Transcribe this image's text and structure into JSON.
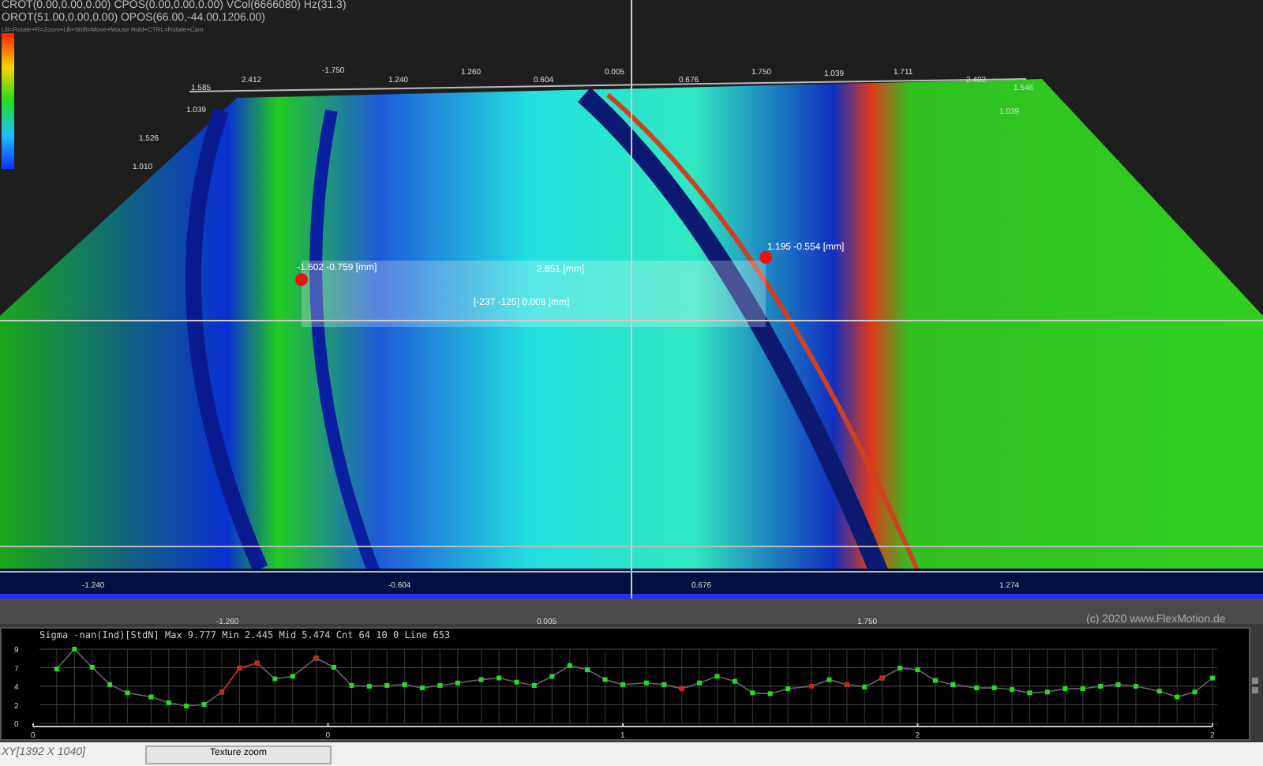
{
  "header": {
    "lines": [
      "CROT(0.00,0.00,0.00) CPOS(0.00,0.00,0.00) VCol(6666080) Hz(31.3)",
      "OROT(51.00,0.00,0.00) OPOS(66.00,-44.00,1206.00)"
    ],
    "hint": "LB=Rotate+R=Zoom+LB+Shift=Move+Mouse Hold+CTRL=Rotate+Cam"
  },
  "axis_labels": [
    "1.585",
    "2.412",
    "-1.750",
    "1.240",
    "1.260",
    "0.604",
    "0.005",
    "0.676",
    "1.750",
    "1.039",
    "1.711",
    "2.402",
    "1.546",
    "1.039",
    "1.526",
    "1.010",
    "1.039",
    "-1.240",
    "-0.604",
    "0.676",
    "1.274",
    "-1.260",
    "0.005",
    "1.750"
  ],
  "measurements": [
    "-1.602 -0.759 [mm]",
    "2.851 [mm]",
    "[-237 -125] 0.008 [mm]",
    "1.195 -0.554 [mm]"
  ],
  "copyright": "(c) 2020 www.FlexMotion.de",
  "profile": {
    "chart_data": {
      "type": "line",
      "title": "Sigma -nan(Ind)[StdN] Max 9.777 Min 2.445 Mid 5.474 Cnt 64 10 0 Line 653",
      "grid": true,
      "xlim": [
        0,
        2
      ],
      "ylim": [
        0,
        9
      ],
      "yticks": [
        {
          "value": 0,
          "label": "0"
        },
        {
          "value": 2.25,
          "label": "2"
        },
        {
          "value": 4.5,
          "label": "4"
        },
        {
          "value": 6.75,
          "label": "7"
        },
        {
          "value": 9,
          "label": "9"
        }
      ],
      "xticks": [
        {
          "value": 0,
          "label": "0"
        },
        {
          "value": 0.5,
          "label": "0"
        },
        {
          "value": 1,
          "label": "1"
        },
        {
          "value": 1.5,
          "label": "2"
        },
        {
          "value": 2,
          "label": "2"
        }
      ],
      "x": [
        0.04,
        0.07,
        0.1,
        0.13,
        0.16,
        0.2,
        0.23,
        0.26,
        0.29,
        0.32,
        0.35,
        0.38,
        0.41,
        0.44,
        0.48,
        0.51,
        0.54,
        0.57,
        0.6,
        0.63,
        0.66,
        0.69,
        0.72,
        0.76,
        0.79,
        0.82,
        0.85,
        0.88,
        0.91,
        0.94,
        0.97,
        1.0,
        1.04,
        1.07,
        1.1,
        1.13,
        1.16,
        1.19,
        1.22,
        1.25,
        1.28,
        1.32,
        1.35,
        1.38,
        1.41,
        1.44,
        1.47,
        1.5,
        1.53,
        1.56,
        1.6,
        1.63,
        1.66,
        1.69,
        1.72,
        1.75,
        1.78,
        1.81,
        1.84,
        1.87,
        1.91,
        1.94,
        1.97,
        2.0
      ],
      "series": [
        {
          "color": "#22dd22",
          "marker": "square",
          "values": [
            6.6,
            9.0,
            6.8,
            4.7,
            3.7,
            3.2,
            2.5,
            2.1,
            2.3,
            3.8,
            6.7,
            7.3,
            5.4,
            5.7,
            7.9,
            6.8,
            4.6,
            4.5,
            4.6,
            4.7,
            4.3,
            4.6,
            4.9,
            5.3,
            5.5,
            5.0,
            4.6,
            5.7,
            7.0,
            6.5,
            5.3,
            4.7,
            4.9,
            4.7,
            4.2,
            4.9,
            5.7,
            5.1,
            3.7,
            3.6,
            4.2,
            4.5,
            5.3,
            4.7,
            4.4,
            5.5,
            6.7,
            6.5,
            5.2,
            4.7,
            4.3,
            4.3,
            4.1,
            3.7,
            3.8,
            4.2,
            4.2,
            4.5,
            4.7,
            4.5,
            3.9,
            3.2,
            3.8,
            5.5
          ]
        },
        {
          "color": "#cc2222",
          "marker": "square",
          "values": [
            null,
            null,
            null,
            null,
            null,
            null,
            null,
            null,
            null,
            3.8,
            6.7,
            7.3,
            null,
            null,
            7.9,
            null,
            null,
            null,
            null,
            null,
            null,
            null,
            null,
            null,
            null,
            null,
            null,
            null,
            null,
            null,
            null,
            null,
            null,
            null,
            4.2,
            null,
            null,
            null,
            null,
            null,
            null,
            4.5,
            null,
            4.7,
            null,
            5.5,
            null,
            null,
            null,
            null,
            null,
            null,
            null,
            null,
            null,
            null,
            null,
            null,
            null,
            null,
            null,
            null,
            null,
            null
          ]
        }
      ]
    }
  },
  "status_bar": {
    "resolution": "XY[1392 X 1040]",
    "button": "Texture zoom"
  }
}
